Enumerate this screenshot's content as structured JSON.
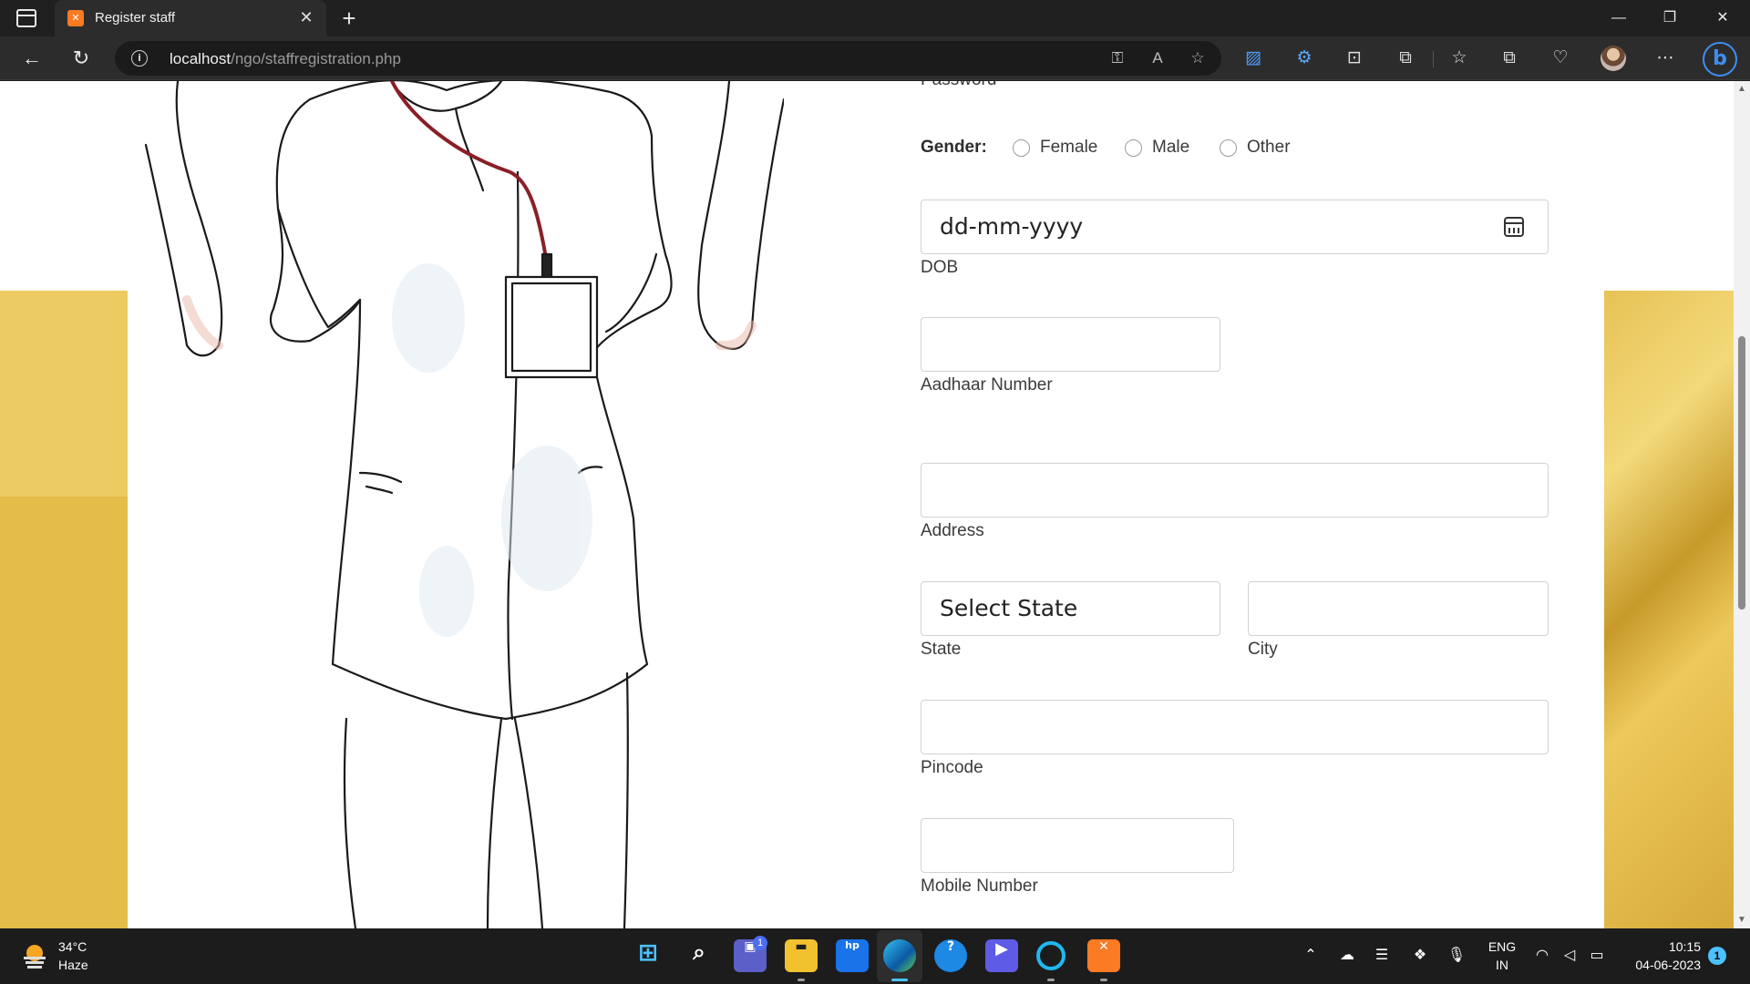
{
  "browser": {
    "tab": {
      "title": "Register staff",
      "favicon": "xampp-icon"
    },
    "url_host": "localhost",
    "url_path": "/ngo/staffregistration.php",
    "bing_label": "b"
  },
  "form": {
    "cut_off_label": "Password",
    "gender": {
      "label": "Gender:",
      "options": [
        "Female",
        "Male",
        "Other"
      ]
    },
    "dob": {
      "value": "dd-mm-yyyy",
      "label": "DOB"
    },
    "aadhaar": {
      "value": "",
      "label": "Aadhaar Number"
    },
    "address": {
      "value": "",
      "label": "Address"
    },
    "state": {
      "value": "Select State",
      "label": "State"
    },
    "city": {
      "value": "",
      "label": "City"
    },
    "pincode": {
      "value": "",
      "label": "Pincode"
    },
    "mobile": {
      "value": "",
      "label": "Mobile Number"
    }
  },
  "taskbar": {
    "weather": {
      "temp": "34°C",
      "condition": "Haze"
    },
    "language": {
      "line1": "ENG",
      "line2": "IN"
    },
    "clock": {
      "time": "10:15",
      "date": "04-06-2023"
    },
    "notification_count": "1",
    "teams_badge": "1"
  },
  "colors": {
    "page_gold": "#e3bc4a",
    "active_indicator": "#4cc2ff",
    "favicon_orange": "#fb7a24"
  }
}
